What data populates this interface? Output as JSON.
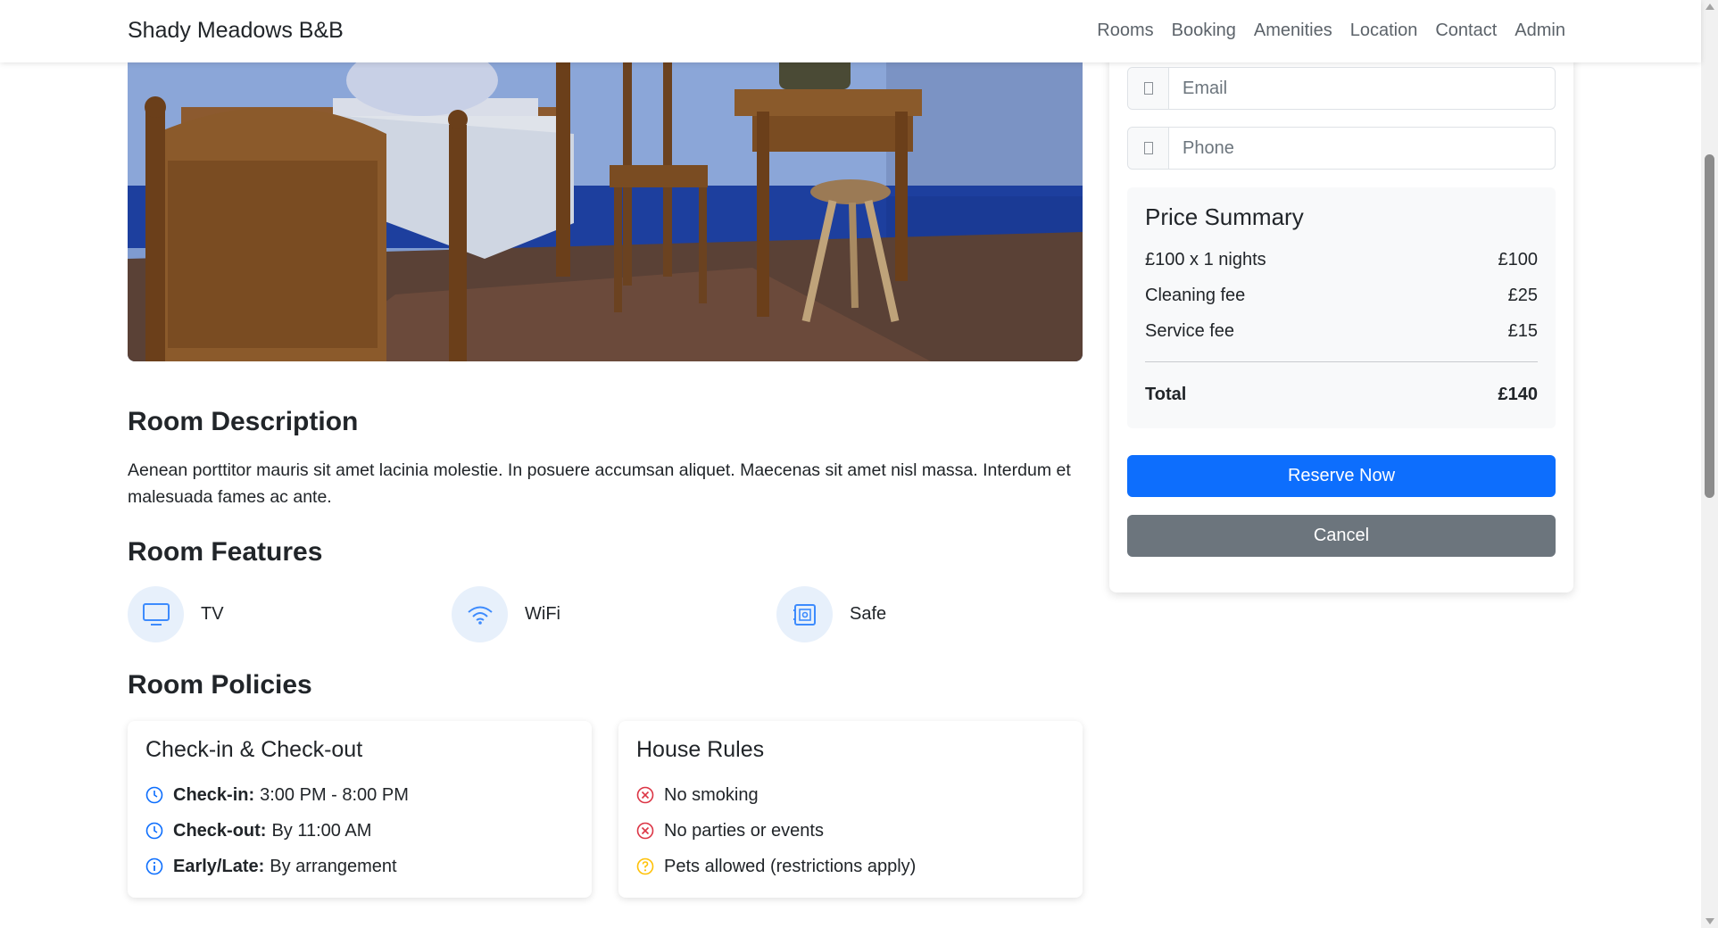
{
  "nav": {
    "brand": "Shady Meadows B&B",
    "links": [
      "Rooms",
      "Booking",
      "Amenities",
      "Location",
      "Contact",
      "Admin"
    ]
  },
  "room": {
    "description_heading": "Room Description",
    "description": "Aenean porttitor mauris sit amet lacinia molestie. In posuere accumsan aliquet. Maecenas sit amet nisl massa. Interdum et malesuada fames ac ante.",
    "features_heading": "Room Features",
    "features": [
      {
        "label": "TV",
        "icon": "tv-icon"
      },
      {
        "label": "WiFi",
        "icon": "wifi-icon"
      },
      {
        "label": "Safe",
        "icon": "safe-icon"
      }
    ],
    "policies_heading": "Room Policies"
  },
  "policies": {
    "checkin": {
      "title": "Check-in & Check-out",
      "rows": [
        {
          "label": "Check-in:",
          "value": "3:00 PM - 8:00 PM",
          "icon": "clock-icon"
        },
        {
          "label": "Check-out:",
          "value": "By 11:00 AM",
          "icon": "clock-icon"
        },
        {
          "label": "Early/Late:",
          "value": "By arrangement",
          "icon": "info-icon"
        }
      ]
    },
    "rules": {
      "title": "House Rules",
      "rows": [
        {
          "value": "No smoking",
          "icon": "x-circle-icon"
        },
        {
          "value": "No parties or events",
          "icon": "x-circle-icon"
        },
        {
          "value": "Pets allowed (restrictions apply)",
          "icon": "question-circle-icon"
        }
      ]
    }
  },
  "booking": {
    "email_placeholder": "Email",
    "phone_placeholder": "Phone",
    "price_summary": {
      "title": "Price Summary",
      "rows": [
        {
          "label": "£100 x 1 nights",
          "amount": "£100"
        },
        {
          "label": "Cleaning fee",
          "amount": "£25"
        },
        {
          "label": "Service fee",
          "amount": "£15"
        }
      ],
      "total_label": "Total",
      "total_amount": "£140"
    },
    "reserve_label": "Reserve Now",
    "cancel_label": "Cancel"
  },
  "colors": {
    "primary": "#0d6efd",
    "secondary": "#6c757d",
    "feature_icon": "#3d8bfd",
    "danger_icon": "#dc3545",
    "warning_icon": "#ffc107"
  }
}
